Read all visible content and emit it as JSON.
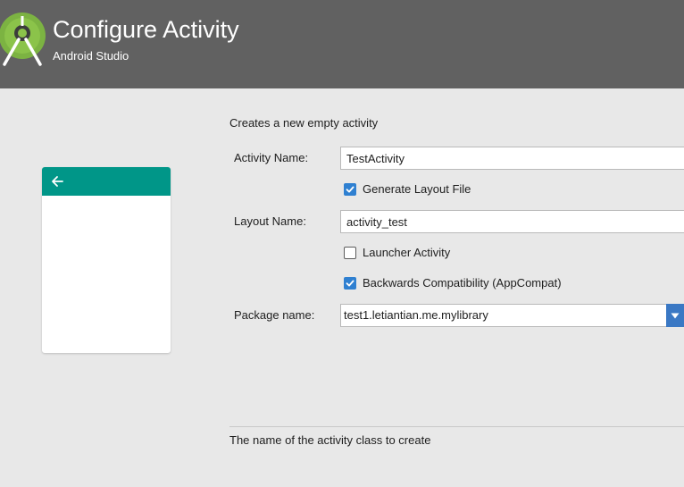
{
  "header": {
    "title": "Configure Activity",
    "subtitle": "Android Studio",
    "logo_icon": "android-studio-logo",
    "background": "#616161"
  },
  "preview": {
    "toolbar_color": "#009688",
    "back_icon": "arrow-left-icon"
  },
  "form": {
    "description": "Creates a new empty activity",
    "activity_name": {
      "label": "Activity Name:",
      "value": "TestActivity"
    },
    "generate_layout": {
      "label": "Generate Layout File",
      "checked": true
    },
    "layout_name": {
      "label": "Layout Name:",
      "value": "activity_test"
    },
    "launcher_activity": {
      "label": "Launcher Activity",
      "checked": false
    },
    "backwards_compat": {
      "label": "Backwards Compatibility (AppCompat)",
      "checked": true
    },
    "package_name": {
      "label": "Package name:",
      "value": "test1.letiantian.me.mylibrary"
    }
  },
  "footer": {
    "hint": "The name of the activity class to create"
  },
  "colors": {
    "accent": "#2f80d1",
    "page_bg": "#e8e8e8"
  }
}
